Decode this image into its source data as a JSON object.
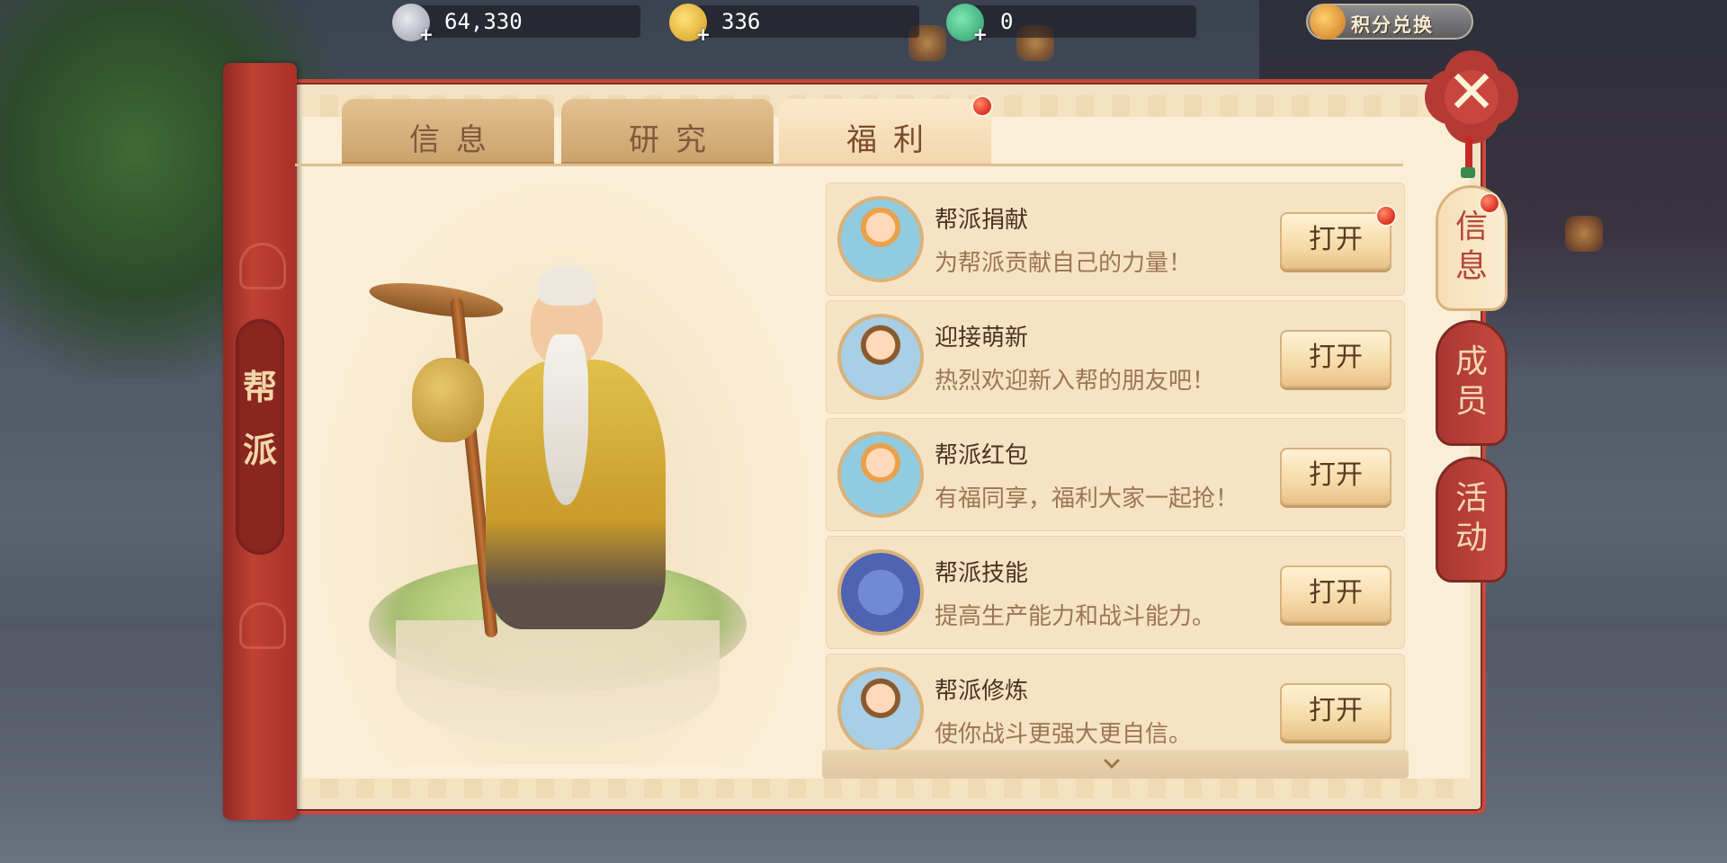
{
  "currency": {
    "silver": {
      "icon": "silver-coin-icon",
      "value": "64,330"
    },
    "gold": {
      "icon": "gold-coin-icon",
      "value": "336"
    },
    "jade": {
      "icon": "jade-dragon-icon",
      "value": "0"
    },
    "points_exchange_label": "积分兑换"
  },
  "banner": {
    "char1": "帮",
    "char2": "派"
  },
  "tabs": [
    {
      "label": "信息",
      "active": false
    },
    {
      "label": "研究",
      "active": false
    },
    {
      "label": "福利",
      "active": true
    }
  ],
  "welfare_items": [
    {
      "name": "帮派捐献",
      "desc": "为帮派贡献自己的力量！",
      "button": "打开",
      "badge": true,
      "icon": "donation-avatar-icon"
    },
    {
      "name": "迎接萌新",
      "desc": "热烈欢迎新入帮的朋友吧！",
      "button": "打开",
      "badge": false,
      "icon": "welcome-twins-avatar-icon"
    },
    {
      "name": "帮派红包",
      "desc": "有福同享，福利大家一起抢！",
      "button": "打开",
      "badge": false,
      "icon": "red-packet-avatar-icon"
    },
    {
      "name": "帮派技能",
      "desc": "提高生产能力和战斗能力。",
      "button": "打开",
      "badge": false,
      "icon": "skill-book-icon"
    },
    {
      "name": "帮派修炼",
      "desc": "使你战斗更强大更自信。",
      "button": "打开",
      "badge": false,
      "icon": "cultivation-avatar-icon"
    }
  ],
  "side_tabs": [
    {
      "label1": "信",
      "label2": "息",
      "active": true,
      "badge": true
    },
    {
      "label1": "成",
      "label2": "员",
      "active": false,
      "badge": false
    },
    {
      "label1": "活",
      "label2": "动",
      "active": false,
      "badge": false
    }
  ],
  "colors": {
    "panel": "#fbeed6",
    "accent_red": "#c8493b",
    "badge_red": "#e23d2b"
  }
}
